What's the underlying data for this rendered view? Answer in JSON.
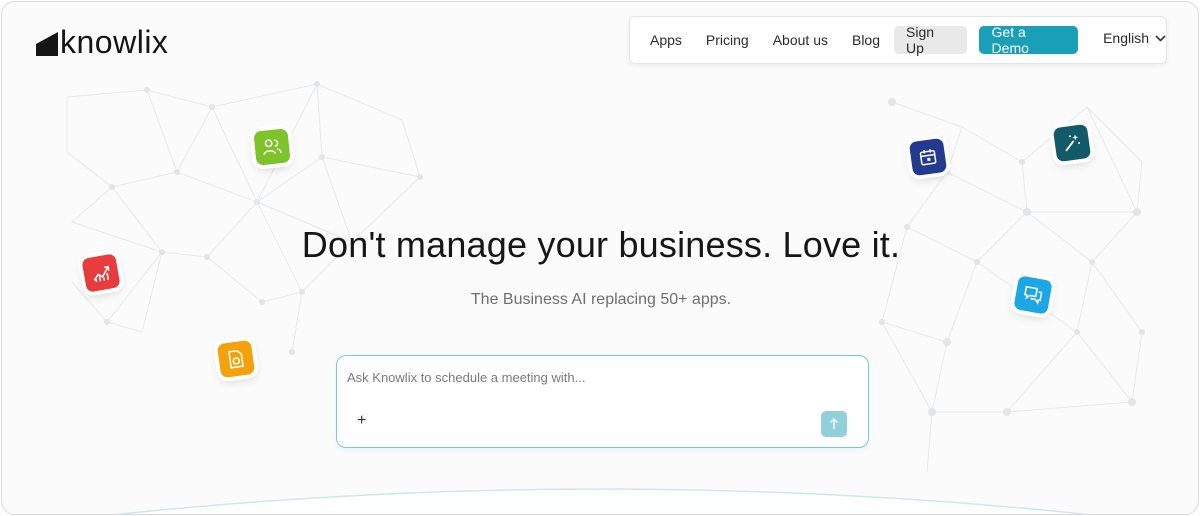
{
  "logo": {
    "text": "knowlix"
  },
  "nav": {
    "links": [
      "Apps",
      "Pricing",
      "About us",
      "Blog"
    ],
    "signup_label": "Sign Up",
    "demo_label": "Get a Demo",
    "language": "English"
  },
  "hero": {
    "headline": "Don't manage your business. Love it.",
    "subhead": "The Business AI replacing 50+ apps."
  },
  "prompt": {
    "placeholder": "Ask Knowlix to schedule a meeting with...",
    "value": "",
    "attach_icon": "plus-icon",
    "send_icon": "arrow-up-icon"
  },
  "tiles": [
    {
      "icon": "users-icon",
      "color": "#7cc42a"
    },
    {
      "icon": "chart-icon",
      "color": "#e83b3b"
    },
    {
      "icon": "document-icon",
      "color": "#f4a20b"
    },
    {
      "icon": "calendar-icon",
      "color": "#233a8f"
    },
    {
      "icon": "magic-wand-icon",
      "color": "#125a68"
    },
    {
      "icon": "chat-icon",
      "color": "#1ca6e6"
    }
  ],
  "colors": {
    "accent": "#1a9fb8",
    "prompt_border": "#7cc7d6",
    "send_button": "#8fd0dc"
  }
}
